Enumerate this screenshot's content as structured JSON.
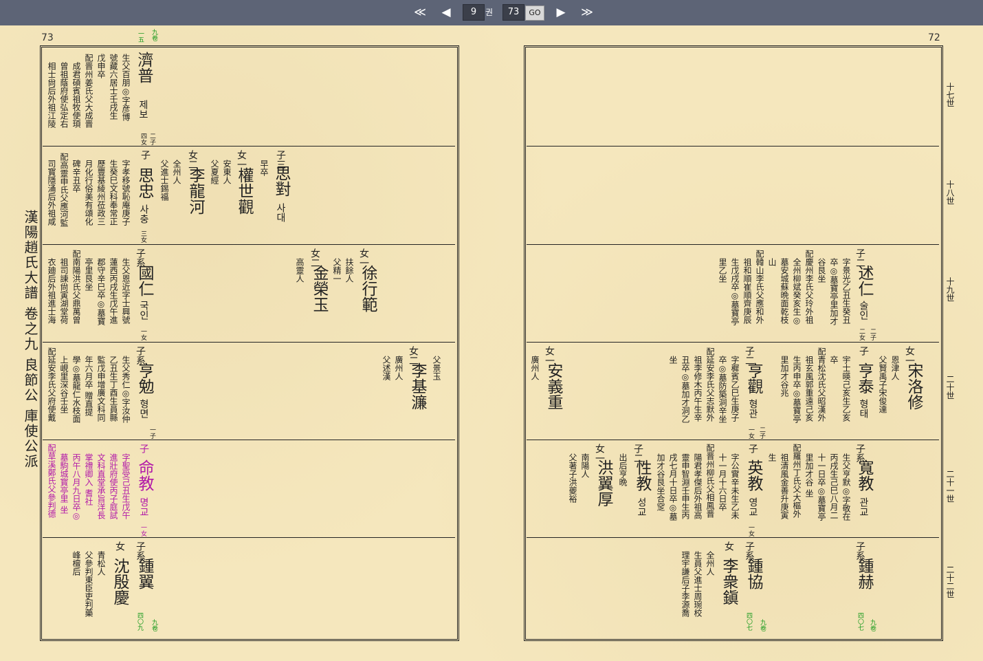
{
  "toolbar": {
    "first_label": "≪",
    "prev_label": "◀",
    "volume_value": "9",
    "volume_unit": "권",
    "page_value": "73",
    "go_label": "GO",
    "next_label": "▶",
    "last_label": "≫"
  },
  "left_page": {
    "number": "73",
    "spine": "漢陽趙氏大譜 卷之九 良節公 庫使公派",
    "vol_ref_top_a": "九卷",
    "vol_ref_top_b": "一五",
    "vol_ref_bot_a": "九卷",
    "vol_ref_bot_b": "四〇九",
    "rows": [
      {
        "name": "濟普",
        "kor": "제보",
        "rel": "二子",
        "rel2": "四女",
        "lines": [
          "生父百朋◎字彦博",
          "號藏六居士壬戌生",
          "戊申卒",
          "配晋州姜氏父大成晋",
          "成君碩賓祖牧使頊",
          "曾祖蔭府使弘定右",
          "相士尙后外祖江陵"
        ]
      },
      {
        "name": "思對",
        "kor": "사대",
        "rel": "子三",
        "note": "早卒",
        "f1_rel": "女一",
        "f1_name": "權世觀",
        "f1_lines": [
          "安東人",
          "父夏經"
        ],
        "f2_rel": "女二",
        "f2_name": "李龍河",
        "f2_lines": [
          "全州人",
          "父進士錫福"
        ],
        "s_rel": "子",
        "s_name": "思忠",
        "s_kor": "사충",
        "s_rel2": "三女",
        "s_lines": [
          "字孝移號恥庵庚子",
          "生癸巳文科奉常正",
          "歷豐基綾州莅政三",
          "月化行俗美有頌化",
          "碑辛丑卒",
          "配高靈申氏父應河監",
          "司寳隱涌后外祖咸"
        ]
      },
      {
        "f1_rel": "女一",
        "f1_name": "徐行範",
        "f1_lines": [
          "扶餘人",
          "父精一"
        ],
        "f2_rel": "女二",
        "f2_name": "金榮玉",
        "f2_lines": [
          "高靈人"
        ],
        "s_rel": "子系",
        "s_name": "國仁",
        "s_kor": "국인",
        "s_rel2": "一女",
        "s_lines": [
          "生父恩近字士興號",
          "蓮西丙戌生戊午進",
          "郡守辛巳卒◎墓寶",
          "亭里艮坐",
          "配南陽洪氏父鼎萬曾",
          "祖司諫尙寅湖堂荷",
          "衣廸后外祖進士海"
        ]
      },
      {
        "f_rel": "女二",
        "f_name": "李基濂",
        "f_lines": [
          "廣州人",
          "父述漢"
        ],
        "f_extra": "父景玉",
        "s_rel": "子系",
        "s_name": "亨勉",
        "s_kor": "형면",
        "s_rel2": "一子",
        "s_lines": [
          "生父秀仁◎字汝仲",
          "乙丑生丁酉生員縣",
          "監戊申增廣文科同",
          "年六月卒 贈直提",
          "學◎墓龍仁水枝面",
          "上峴里深谷壬坐",
          "配延安李氏父府使戴"
        ]
      },
      {
        "s_rel": "子",
        "s_name": "命教",
        "s_kor": "명교",
        "s_rel2": "一女",
        "s_lines": [
          "字聖受己丑生戊午",
          "進壯府使丙子庭試",
          "文科直堂承旨洋長",
          "掌禮卿入 耆社",
          "丙午八月九日卒◎",
          "墓駒城寳亭里 坐",
          "配草溪鄭氏父參判德"
        ]
      },
      {
        "s_rel": "子系",
        "s_name": "鍾翼",
        "f_rel": "女",
        "f_name": "沈殷慶",
        "f_lines": [
          "青松人",
          "父參判東臣吏判藥",
          "峰檀后"
        ]
      }
    ]
  },
  "right_page": {
    "number": "72",
    "generations": [
      "十七世",
      "十八世",
      "十九世",
      "二十世",
      "二十一世",
      "二十二世"
    ],
    "vol_ref_a": "九卷",
    "vol_ref_b1": "四〇七",
    "vol_ref_b2": "四〇七",
    "rows": [
      {},
      {},
      {
        "s_rel": "子二",
        "s_name": "述仁",
        "s_kor": "술인",
        "s_rel2": "二女",
        "s_rel3": "二子",
        "s_lines": [
          "字景光乙丑生癸丑",
          "卒◎墓寶亭里加才",
          "谷艮坐",
          "配慶州李氏父玲外祖",
          "全州柳斌癸亥生◎",
          "墓安城蘇晩面乾枝",
          "山",
          "配韓山李氏父應和外",
          "祖和順崔順齊庚辰",
          "生戊戌卒◎墓寶亭",
          "里乙坐"
        ]
      },
      {
        "f1_rel": "女一",
        "f1_name": "宋洛修",
        "f1_lines": [
          "恩津人",
          "父賢禹子宋俊達"
        ],
        "s1_rel": "子",
        "s1_name": "亨泰",
        "s1_kor": "형태",
        "s1_lines": [
          "宇士暎己亥生乙亥",
          "卒",
          "配青松沈氏父昭漢外",
          "祖玄風郭重遠己亥",
          "生丙申卒◎墓寶亭",
          "里加才谷兆"
        ],
        "s2_rel": "子二",
        "s2_name": "亨觀",
        "s2_kor": "형관",
        "s2_rel2": "一女",
        "s2_rel3": "二子",
        "s2_lines": [
          "字穉賓乙巳生庚子",
          "卒◎墓防築洞辛坐",
          "配延安李氏父志默外",
          "祖李修木丙午生辛",
          "丑卒◎墓加才洞乙",
          "坐"
        ],
        "f2_rel": "女一",
        "f2_name": "安義重",
        "f2_lines": [
          "廣州人"
        ]
      },
      {
        "s1_rel": "子系",
        "s1_name": "寬教",
        "s1_kor": "관교",
        "s1_lines": [
          "生父亨默◎字敬在",
          "丙戌生己巳八月二",
          "十一日卒◎墓寶亭",
          "里加才谷 坐",
          "配羅州丁氏父大樞外",
          "祖清風金善升庚寅",
          "生"
        ],
        "s2_rel": "子",
        "s2_name": "英教",
        "s2_kor": "영교",
        "s2_rel2": "一女",
        "s2_lines": [
          "字公實辛未生乙未",
          "十一月十六日卒",
          "配晋州柳氏父相鳳晋",
          "陽君孝傑后外祖高",
          "靈申智淵壬申生丙",
          "戌七月十日卒◎墓",
          "加才谷艮坐合窆"
        ],
        "s3_rel": "子二",
        "s3_name": "性教",
        "s3_kor": "성교",
        "s3_lines": [
          "出后亨晩"
        ],
        "f_rel": "女一",
        "f_name": "洪翼厚",
        "f_lines": [
          "南陽人",
          "父著子洪夔裕"
        ]
      },
      {
        "s1_rel": "子系",
        "s1_name": "鍾赫",
        "s2_rel": "子系",
        "s2_name": "鍾協",
        "f_rel": "女",
        "f_name": "李衆鎭",
        "f_lines": [
          "全州人",
          "生員父進士周琬校",
          "理宇謙后子李源喬"
        ]
      }
    ]
  }
}
